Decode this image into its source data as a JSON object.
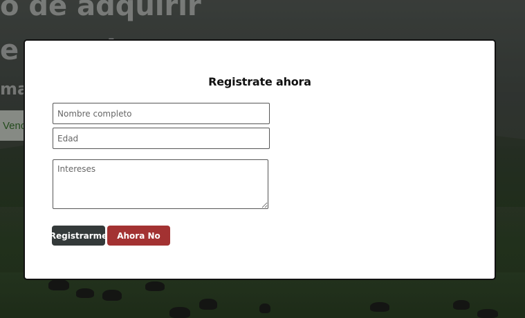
{
  "background": {
    "hero_line_1": "o de adquirir",
    "hero_line_2": "e ma  ..it",
    "hero_line_3": "ma",
    "hero_button_label": "Vend"
  },
  "modal": {
    "title": "Registrate ahora",
    "name_placeholder": "Nombre completo",
    "age_placeholder": "Edad",
    "interests_placeholder": "Intereses",
    "register_label": "Registrarme",
    "later_label": "Ahora No"
  },
  "colors": {
    "register_button": "#343a3a",
    "later_button": "#a33232",
    "modal_bg": "#ffffff"
  }
}
